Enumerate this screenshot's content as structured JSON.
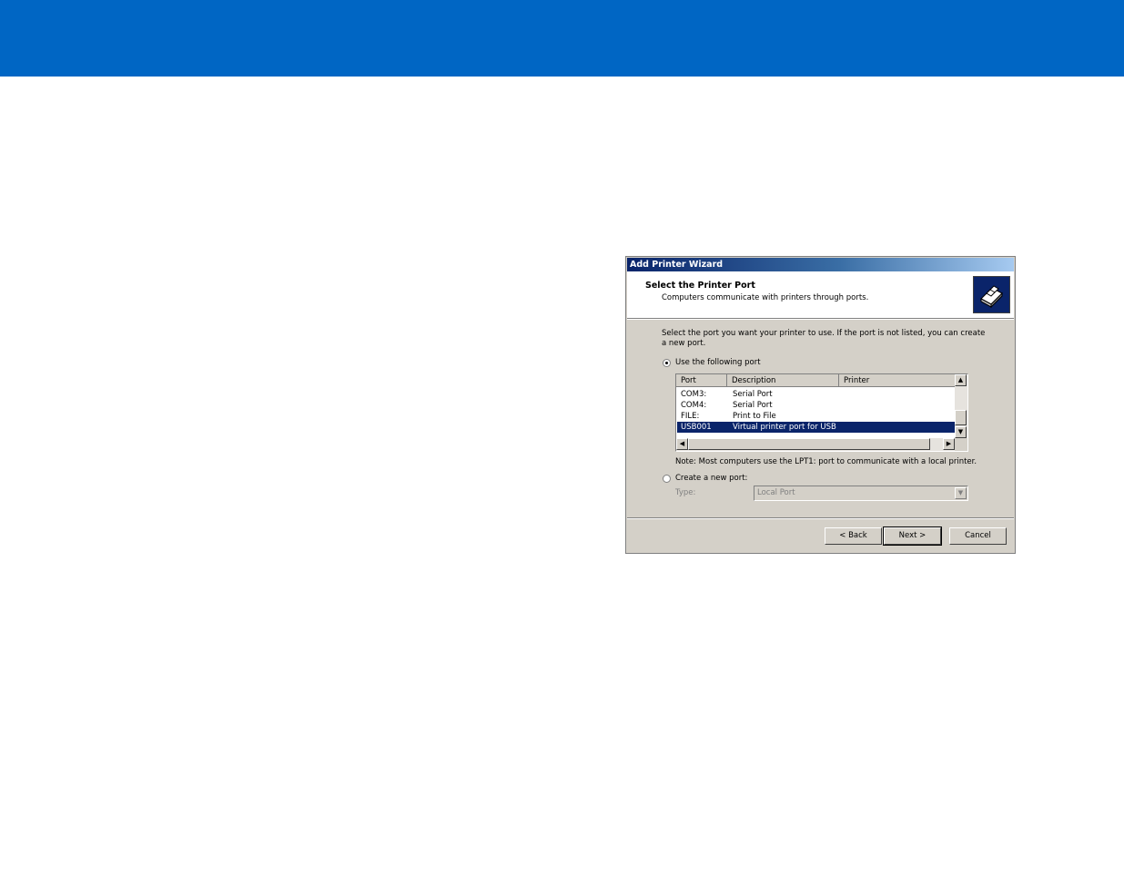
{
  "window": {
    "title": "Add Printer Wizard"
  },
  "header": {
    "title": "Select the Printer Port",
    "subtitle": "Computers communicate with printers through ports."
  },
  "intro_text": "Select the port you want your printer to use.  If the port is not listed, you can create a new port.",
  "use_port": {
    "label": "Use the following port",
    "checked": true
  },
  "port_list": {
    "columns": [
      "Port",
      "Description",
      "Printer"
    ],
    "rows": [
      {
        "port": "COM3:",
        "description": "Serial Port",
        "printer": "",
        "selected": false
      },
      {
        "port": "COM4:",
        "description": "Serial Port",
        "printer": "",
        "selected": false
      },
      {
        "port": "FILE:",
        "description": "Print to File",
        "printer": "",
        "selected": false
      },
      {
        "port": "USB001",
        "description": "Virtual printer port for USB",
        "printer": "",
        "selected": true
      }
    ]
  },
  "note": "Note: Most computers use the LPT1: port to communicate with a local printer.",
  "create_port": {
    "label": "Create a new port:",
    "checked": false,
    "type_label": "Type:",
    "type_value": "Local Port"
  },
  "buttons": {
    "back": "< Back",
    "next": "Next >",
    "cancel": "Cancel"
  },
  "colors": {
    "banner": "#0066c4",
    "selection": "#0a246a",
    "dialog_face": "#d4d0c8"
  }
}
